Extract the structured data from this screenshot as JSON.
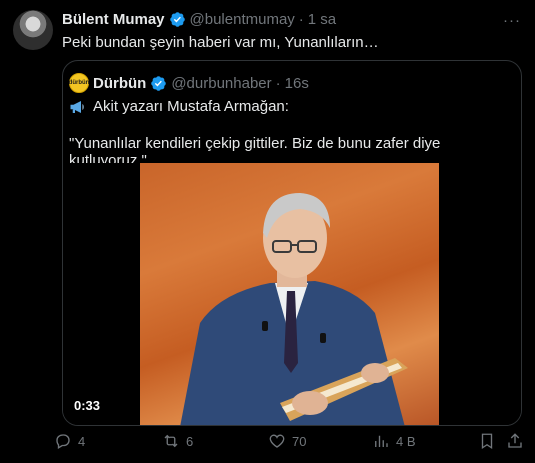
{
  "tweet": {
    "name": "Bülent Mumay",
    "handle": "@bulentmumay",
    "separator": "·",
    "time": "1 sa",
    "text": "Peki bundan şeyin haberi var mı, Yunanlıların…",
    "more": "···"
  },
  "quoted": {
    "logo_text": "dürbün",
    "name": "Dürbün",
    "handle": "@durbunhaber",
    "separator": "·",
    "time": "16s",
    "line1": "Akit yazarı Mustafa Armağan:",
    "line2": "\"Yunanlılar kendileri çekip gittiler. Biz de bunu zafer diye kutluyoruz.\"",
    "video_duration": "0:33"
  },
  "actions": {
    "replies": "4",
    "reposts": "6",
    "likes": "70",
    "views": "4 B"
  },
  "colors": {
    "verified": "#1d9bf0",
    "muted": "#71767b",
    "border": "#2f3336"
  }
}
